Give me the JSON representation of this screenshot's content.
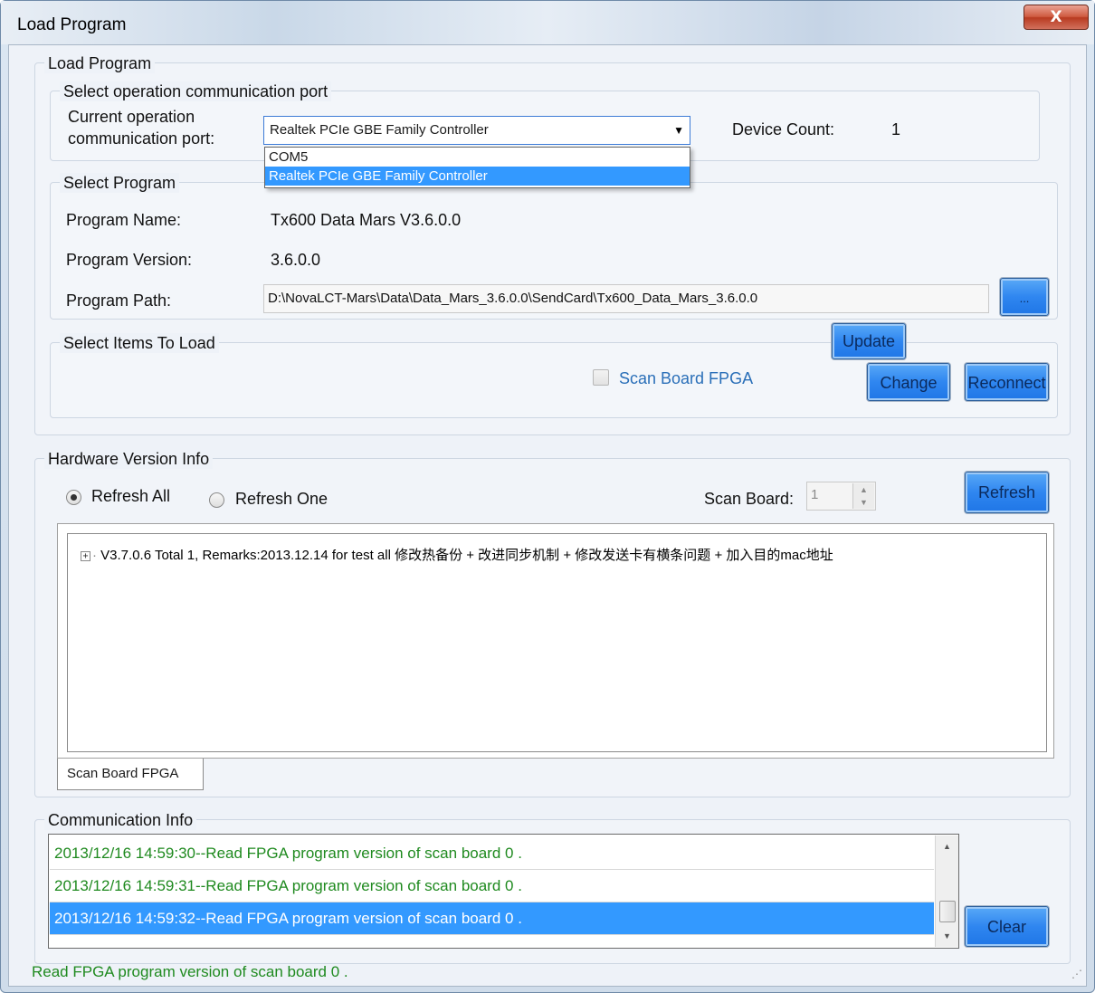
{
  "window": {
    "title": "Load Program",
    "close_glyph": "X"
  },
  "load_program": {
    "group_title": "Load Program",
    "port": {
      "group_title": "Select operation communication port",
      "label_line1": "Current operation",
      "label_line2": "communication port:",
      "selected": "Realtek PCIe GBE Family Controller",
      "options": [
        "COM5",
        "Realtek PCIe GBE Family Controller"
      ],
      "device_count_label": "Device Count:",
      "device_count_value": "1"
    },
    "program": {
      "group_title": "Select Program",
      "name_label": "Program Name:",
      "name_value": "Tx600  Data  Mars  V3.6.0.0",
      "version_label": "Program Version:",
      "version_value": "3.6.0.0",
      "path_label": "Program Path:",
      "path_value": "D:\\NovaLCT-Mars\\Data\\Data_Mars_3.6.0.0\\SendCard\\Tx600_Data_Mars_3.6.0.0",
      "browse_label": "..."
    },
    "items": {
      "group_title": "Select Items To Load",
      "scan_board_fpga_label": "Scan Board FPGA",
      "scan_board_fpga_checked": false
    },
    "buttons": {
      "update": "Update",
      "change": "Change",
      "reconnect": "Reconnect"
    }
  },
  "hardware": {
    "group_title": "Hardware Version Info",
    "refresh_all_label": "Refresh All",
    "refresh_one_label": "Refresh One",
    "selected_mode": "Refresh All",
    "scan_board_label": "Scan Board:",
    "scan_board_value": "1",
    "refresh_button": "Refresh",
    "tree_rows": [
      {
        "expander": "+",
        "text": "V3.7.0.6 Total 1, Remarks:2013.12.14 for test all 修改热备份 + 改进同步机制 + 修改发送卡有横条问题 + 加入目的mac地址"
      }
    ],
    "tab_label": "Scan Board FPGA"
  },
  "communication": {
    "group_title": "Communication Info",
    "log": [
      "2013/12/16 14:59:30--Read FPGA program version of scan board 0 .",
      "2013/12/16 14:59:31--Read FPGA program version of scan board 0 .",
      "2013/12/16 14:59:32--Read FPGA program version of scan board 0 ."
    ],
    "selected_index": 2,
    "clear_button": "Clear"
  },
  "status_bar": {
    "text": "Read FPGA program version of scan board 0 ."
  },
  "colors": {
    "accent_button": "#2f86f0",
    "selection": "#3399ff",
    "log_text": "#1f8a1f"
  }
}
